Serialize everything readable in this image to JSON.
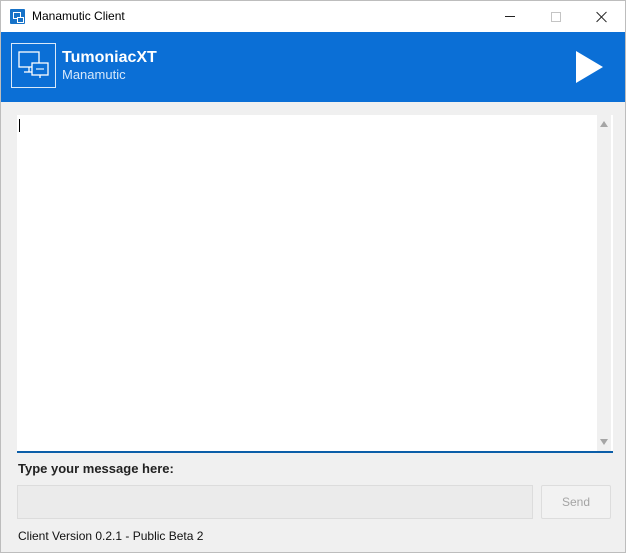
{
  "window": {
    "title": "Manamutic Client"
  },
  "header": {
    "brand_title": "TumoniacXT",
    "brand_subtitle": "Manamutic",
    "logo_icon": "monitors-icon",
    "play_icon": "play-icon",
    "accent_color": "#0b6fd6"
  },
  "chat": {
    "content": ""
  },
  "composer": {
    "label": "Type your message here:",
    "input_value": "",
    "send_label": "Send"
  },
  "footer": {
    "version": "Client Version 0.2.1 - Public Beta 2"
  }
}
